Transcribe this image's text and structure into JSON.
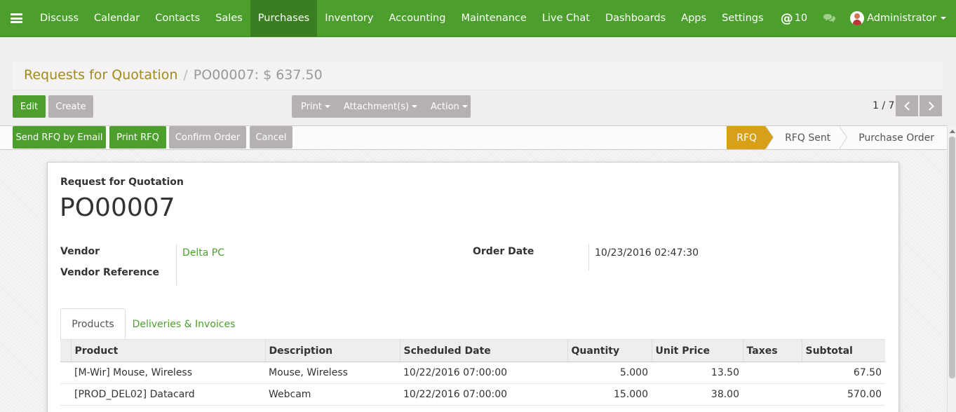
{
  "nav": {
    "items": [
      "Discuss",
      "Calendar",
      "Contacts",
      "Sales",
      "Purchases",
      "Inventory",
      "Accounting",
      "Maintenance",
      "Live Chat",
      "Dashboards",
      "Apps",
      "Settings"
    ],
    "active": "Purchases",
    "mentions_count": "10",
    "user": "Administrator"
  },
  "breadcrumb": {
    "parent": "Requests for Quotation",
    "separator": "/",
    "current": "PO00007: $ 637.50"
  },
  "buttons": {
    "edit": "Edit",
    "create": "Create",
    "print": "Print",
    "attachments": "Attachment(s)",
    "action": "Action",
    "send_rfq": "Send RFQ by Email",
    "print_rfq": "Print RFQ",
    "confirm_order": "Confirm Order",
    "cancel": "Cancel"
  },
  "pager": {
    "value": "1 / 7"
  },
  "stages": [
    {
      "label": "RFQ",
      "active": true
    },
    {
      "label": "RFQ Sent",
      "active": false
    },
    {
      "label": "Purchase Order",
      "active": false
    }
  ],
  "sheet": {
    "subtitle": "Request for Quotation",
    "title": "PO00007",
    "vendor_label": "Vendor",
    "vendor_value": "Delta PC",
    "vendor_ref_label": "Vendor Reference",
    "order_date_label": "Order Date",
    "order_date_value": "10/23/2016 02:47:30"
  },
  "tabs": [
    "Products",
    "Deliveries & Invoices"
  ],
  "lines": {
    "headers": [
      "Product",
      "Description",
      "Scheduled Date",
      "Quantity",
      "Unit Price",
      "Taxes",
      "Subtotal"
    ],
    "rows": [
      [
        "[M-Wir] Mouse, Wireless",
        "Mouse, Wireless",
        "10/22/2016 07:00:00",
        "5.000",
        "13.50",
        "",
        "67.50"
      ],
      [
        "[PROD_DEL02] Datacard",
        "Webcam",
        "10/22/2016 07:00:00",
        "15.000",
        "38.00",
        "",
        "570.00"
      ]
    ]
  },
  "colors": {
    "brand_green": "#4c9f2c",
    "active_stage": "#d8a018",
    "breadcrumb_link": "#a08b16"
  }
}
